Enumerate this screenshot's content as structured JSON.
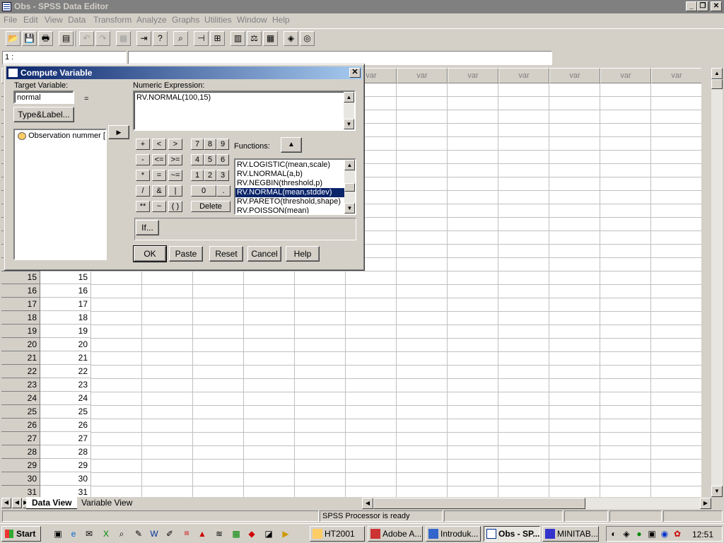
{
  "window": {
    "title": "Obs - SPSS Data Editor"
  },
  "menu": [
    "File",
    "Edit",
    "View",
    "Data",
    "Transform",
    "Analyze",
    "Graphs",
    "Utilities",
    "Window",
    "Help"
  ],
  "cell_editor": {
    "ref": "1 :",
    "value": ""
  },
  "grid": {
    "var_header": "var",
    "rows": [
      {
        "n": "15",
        "v": "15"
      },
      {
        "n": "16",
        "v": "16"
      },
      {
        "n": "17",
        "v": "17"
      },
      {
        "n": "18",
        "v": "18"
      },
      {
        "n": "19",
        "v": "19"
      },
      {
        "n": "20",
        "v": "20"
      },
      {
        "n": "21",
        "v": "21"
      },
      {
        "n": "22",
        "v": "22"
      },
      {
        "n": "23",
        "v": "23"
      },
      {
        "n": "24",
        "v": "24"
      },
      {
        "n": "25",
        "v": "25"
      },
      {
        "n": "26",
        "v": "26"
      },
      {
        "n": "27",
        "v": "27"
      },
      {
        "n": "28",
        "v": "28"
      },
      {
        "n": "29",
        "v": "29"
      },
      {
        "n": "30",
        "v": "30"
      },
      {
        "n": "31",
        "v": "31"
      }
    ]
  },
  "tabs": {
    "data_view": "Data View",
    "variable_view": "Variable View"
  },
  "status": {
    "processor": "SPSS Processor  is ready"
  },
  "dialog": {
    "title": "Compute Variable",
    "target_label": "Target Variable:",
    "target_value": "normal",
    "equals": "=",
    "type_label_button": "Type&Label...",
    "variables": [
      "Observation nummer [o"
    ],
    "expr_label": "Numeric Expression:",
    "expr_value": "RV.NORMAL(100,15)",
    "functions_label": "Functions:",
    "functions": [
      "RV.LOGISTIC(mean,scale)",
      "RV.LNORMAL(a,b)",
      "RV.NEGBIN(threshold,p)",
      "RV.NORMAL(mean,stddev)",
      "RV.PARETO(threshold,shape)",
      "RV.POISSON(mean)"
    ],
    "selected_function": "RV.NORMAL(mean,stddev)",
    "keypad": {
      "ops": [
        [
          "+",
          "<",
          ">"
        ],
        [
          "-",
          "<=",
          ">="
        ],
        [
          "*",
          "=",
          "~="
        ],
        [
          "/",
          "&",
          "|"
        ],
        [
          "**",
          "~",
          "( )"
        ]
      ],
      "digits": [
        [
          "7",
          "8",
          "9"
        ],
        [
          "4",
          "5",
          "6"
        ],
        [
          "1",
          "2",
          "3"
        ]
      ],
      "zero": "0",
      "dot": ".",
      "delete": "Delete"
    },
    "if_button": "If...",
    "buttons": {
      "ok": "OK",
      "paste": "Paste",
      "reset": "Reset",
      "cancel": "Cancel",
      "help": "Help"
    }
  },
  "taskbar": {
    "start": "Start",
    "tasks": [
      "HT2001",
      "Adobe A...",
      "Introduk...",
      "Obs - SP...",
      "MINITAB..."
    ],
    "active_task": "Obs - SP...",
    "clock": "12:51"
  },
  "colors": {
    "titlebar_active": "#0a246a",
    "selection": "#0a246a",
    "face": "#d4d0c8"
  }
}
